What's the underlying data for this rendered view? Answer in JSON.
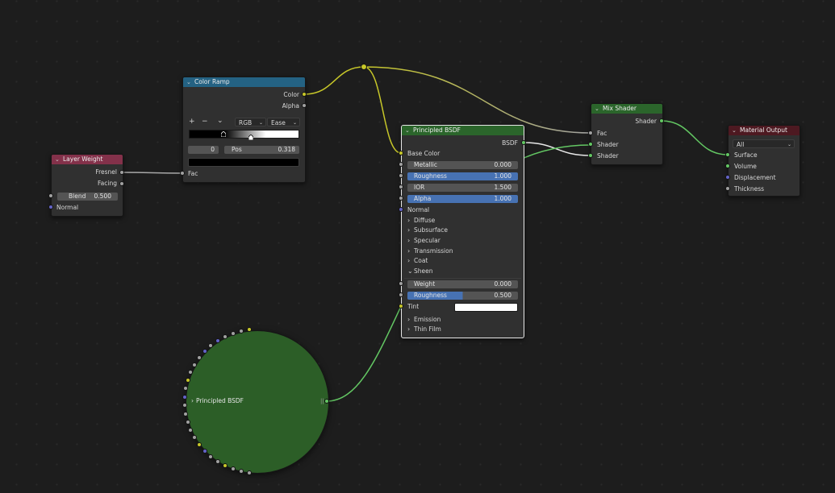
{
  "nodes": {
    "layer_weight": {
      "title": "Layer Weight",
      "outputs": [
        "Fresnel",
        "Facing"
      ],
      "blend": {
        "label": "Blend",
        "value": "0.500"
      },
      "normal_label": "Normal"
    },
    "color_ramp": {
      "title": "Color Ramp",
      "outputs": [
        "Color",
        "Alpha"
      ],
      "add_icon": "+",
      "remove_icon": "−",
      "more_icon": "⌄",
      "color_mode": "RGB",
      "interpolation": "Ease",
      "stop_index": "0",
      "pos_label": "Pos",
      "pos_value": "0.318",
      "fac_label": "Fac",
      "stop_position": 0.318,
      "selected_stop_color": "#000000"
    },
    "principled_bsdf": {
      "title": "Principled BSDF",
      "output": "BSDF",
      "base_color_label": "Base Color",
      "fields": [
        {
          "label": "Metallic",
          "value": "0.000"
        },
        {
          "label": "Roughness",
          "value": "1.000"
        },
        {
          "label": "IOR",
          "value": "1.500"
        },
        {
          "label": "Alpha",
          "value": "1.000"
        }
      ],
      "normal_label": "Normal",
      "panels": [
        "Diffuse",
        "Subsurface",
        "Specular",
        "Transmission",
        "Coat"
      ],
      "sheen": {
        "label": "Sheen",
        "weight": {
          "label": "Weight",
          "value": "0.000"
        },
        "roughness": {
          "label": "Roughness",
          "value": "0.500",
          "fill": 0.5
        },
        "tint_label": "Tint",
        "tint_color": "#ffffff"
      },
      "panels_after": [
        "Emission",
        "Thin Film"
      ]
    },
    "mix_shader": {
      "title": "Mix Shader",
      "output": "Shader",
      "inputs": [
        "Fac",
        "Shader",
        "Shader"
      ]
    },
    "material_output": {
      "title": "Material Output",
      "target": "All",
      "inputs": [
        "Surface",
        "Volume",
        "Displacement",
        "Thickness"
      ]
    },
    "collapsed_bsdf": {
      "title": "Principled BSDF"
    }
  },
  "colors": {
    "header_input": "#83314a",
    "header_converter": "#246283",
    "header_shader": "#2b652b",
    "header_output": "#4d1921",
    "socket_color": "#c7c729",
    "socket_float": "#a1a1a1",
    "socket_shader": "#63c763",
    "socket_vector": "#6363c7",
    "field_highlight": "#4772b3"
  }
}
